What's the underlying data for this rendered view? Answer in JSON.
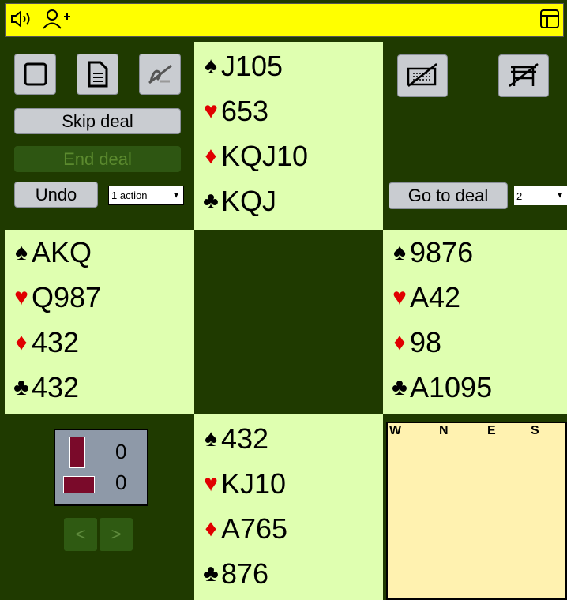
{
  "icons": {
    "speaker": "speaker-icon",
    "add_user": "add-user-icon",
    "layout": "layout-icon",
    "square": "square-icon",
    "document": "document-icon",
    "scribble": "scribble-icon",
    "keyboard_off": "keyboard-off-icon",
    "table_off": "table-off-icon"
  },
  "toolbar": {
    "skip_deal": "Skip deal",
    "end_deal": "End deal",
    "undo": "Undo",
    "undo_select": "1 action",
    "go_to_deal": "Go to deal",
    "deal_select": "2"
  },
  "hands": {
    "north": {
      "spades": "J105",
      "hearts": "653",
      "diamonds": "KQJ10",
      "clubs": "KQJ"
    },
    "west": {
      "spades": "AKQ",
      "hearts": "Q987",
      "diamonds": "432",
      "clubs": "432"
    },
    "east": {
      "spades": "9876",
      "hearts": "A42",
      "diamonds": "98",
      "clubs": "A1095"
    },
    "south": {
      "spades": "432",
      "hearts": "KJ10",
      "diamonds": "A765",
      "clubs": "876"
    }
  },
  "suits": {
    "spades": "♠",
    "hearts": "♥",
    "diamonds": "♦",
    "clubs": "♣"
  },
  "scoreboard": {
    "ns_tricks": "0",
    "ew_tricks": "0"
  },
  "auction": {
    "headers": [
      "W",
      "N",
      "E",
      "S"
    ]
  },
  "nav": {
    "prev": "<",
    "next": ">"
  },
  "colors": {
    "felt": "#1f3a00",
    "hand_bg": "#dfffb0",
    "topbar": "#ffff00",
    "auction_bg": "#fff2b0",
    "red_suit": "#e00000"
  }
}
